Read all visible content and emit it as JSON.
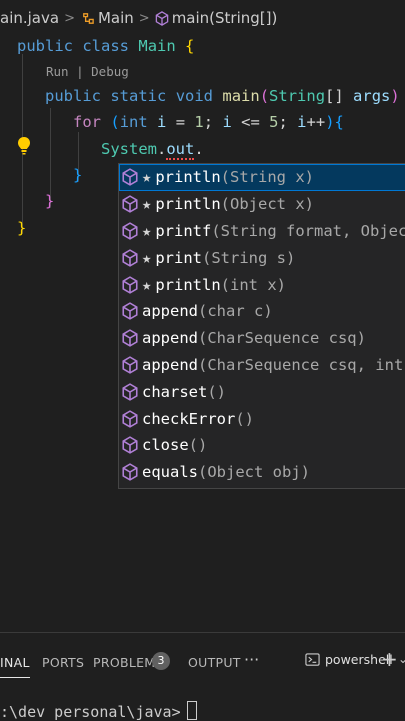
{
  "breadcrumb": {
    "file": "ain.java",
    "class": "Main",
    "method": "main(String[])"
  },
  "editor": {
    "codelens": "Run | Debug",
    "lines": {
      "l1": {
        "kw1": "public",
        "kw2": "class",
        "cls": "Main",
        "brace": "{"
      },
      "l2": {
        "kw1": "public",
        "kw2": "static",
        "kw3": "void",
        "fn": "main",
        "p_open": "(",
        "cls": "String",
        "arr": "[]",
        "var": "args",
        "p_close": ")",
        "brace": "{"
      },
      "l3": {
        "kw": "for",
        "p_open": "(",
        "type": "int",
        "var1": "i",
        "eq": "=",
        "n1": "1",
        "semi1": ";",
        "var2": "i",
        "le": "<=",
        "n2": "5",
        "semi2": ";",
        "var3": "i",
        "inc": "++",
        "p_close": ")",
        "brace": "{"
      },
      "l4": {
        "cls": "System",
        "dot1": ".",
        "field": "out",
        "dot2": "."
      },
      "l5": {
        "brace": "}"
      },
      "l6": {
        "brace": "}"
      },
      "l7": {
        "brace": "}"
      }
    }
  },
  "suggest": {
    "items": [
      {
        "star": "★",
        "name": "println",
        "sig": "(String x)"
      },
      {
        "star": "★",
        "name": "println",
        "sig": "(Object x)"
      },
      {
        "star": "★",
        "name": "printf",
        "sig": "(String format, Object... args)"
      },
      {
        "star": "★",
        "name": "print",
        "sig": "(String s)"
      },
      {
        "star": "★",
        "name": "println",
        "sig": "(int x)"
      },
      {
        "star": "",
        "name": "append",
        "sig": "(char c)"
      },
      {
        "star": "",
        "name": "append",
        "sig": "(CharSequence csq)"
      },
      {
        "star": "",
        "name": "append",
        "sig": "(CharSequence csq, int start, int end)"
      },
      {
        "star": "",
        "name": "charset",
        "sig": "()"
      },
      {
        "star": "",
        "name": "checkError",
        "sig": "()"
      },
      {
        "star": "",
        "name": "close",
        "sig": "()"
      },
      {
        "star": "",
        "name": "equals",
        "sig": "(Object obj)"
      }
    ],
    "icon_color": "#b180d7"
  },
  "panel": {
    "tabs": {
      "terminal": "INAL",
      "ports": "PORTS",
      "problems": "PROBLEMS",
      "problems_count": "3",
      "output": "OUTPUT"
    },
    "more": "···",
    "shell": "powershell",
    "add": "+",
    "chevron": "⌄"
  },
  "terminal": {
    "prompt": ":\\dev personal\\java>"
  }
}
